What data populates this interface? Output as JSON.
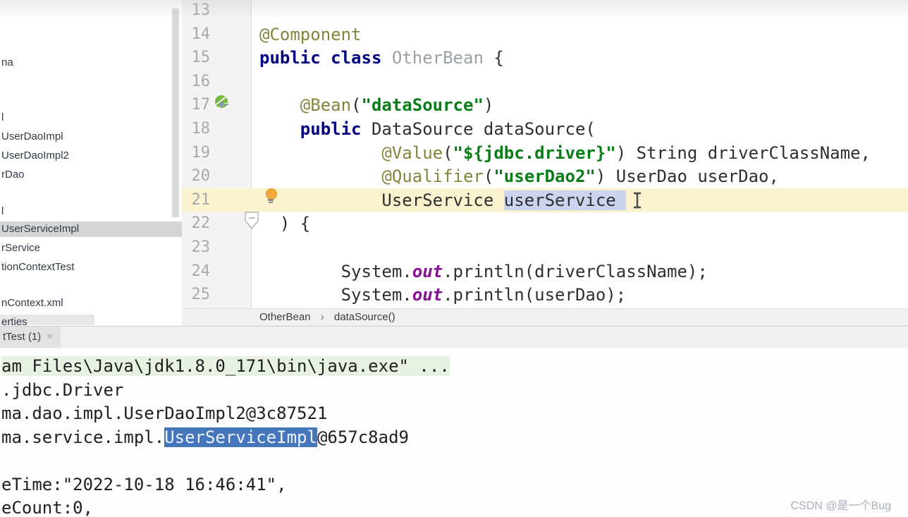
{
  "colors": {
    "keyword": "#000080",
    "annotation": "#84843c",
    "string": "#067d17",
    "static_field": "#871094",
    "caret_row": "#fbf2cf",
    "editor_selection": "#ccd5f0",
    "console_selection": "#4575bb",
    "run_command_highlight": "#e8f2e2",
    "tree_selection": "#d5d5d5"
  },
  "project_tree": {
    "items": [
      {
        "label": "na",
        "selected": false,
        "barred": false
      },
      {
        "label": "l",
        "selected": false,
        "barred": false
      },
      {
        "label": "UserDaoImpl",
        "selected": false,
        "barred": false
      },
      {
        "label": "UserDaoImpl2",
        "selected": false,
        "barred": false
      },
      {
        "label": "rDao",
        "selected": false,
        "barred": false
      },
      {
        "label": "l",
        "selected": false,
        "barred": false
      },
      {
        "label": "UserServiceImpl",
        "selected": true,
        "barred": false
      },
      {
        "label": "rService",
        "selected": false,
        "barred": false
      },
      {
        "label": "tionContextTest",
        "selected": false,
        "barred": false
      },
      {
        "label": "nContext.xml",
        "selected": false,
        "barred": false
      },
      {
        "label": "erties",
        "selected": false,
        "barred": true
      }
    ]
  },
  "editor": {
    "caret_line": 21,
    "lines": [
      {
        "n": 13,
        "tokens": []
      },
      {
        "n": 14,
        "tokens": [
          {
            "c": "a",
            "t": "@Component"
          }
        ]
      },
      {
        "n": 15,
        "tokens": [
          {
            "c": "k",
            "t": "public class "
          },
          {
            "c": "g",
            "t": "OtherBean "
          },
          {
            "c": "p",
            "t": "{"
          }
        ]
      },
      {
        "n": 16,
        "tokens": []
      },
      {
        "n": 17,
        "tokens": [
          {
            "c": "p",
            "t": "    "
          },
          {
            "c": "a",
            "t": "@Bean"
          },
          {
            "c": "p",
            "t": "("
          },
          {
            "c": "s",
            "t": "\"dataSource\""
          },
          {
            "c": "p",
            "t": ")"
          }
        ]
      },
      {
        "n": 18,
        "tokens": [
          {
            "c": "p",
            "t": "    "
          },
          {
            "c": "k",
            "t": "public "
          },
          {
            "c": "p",
            "t": "DataSource dataSource("
          }
        ]
      },
      {
        "n": 19,
        "tokens": [
          {
            "c": "p",
            "t": "            "
          },
          {
            "c": "a",
            "t": "@Value"
          },
          {
            "c": "p",
            "t": "("
          },
          {
            "c": "s",
            "t": "\"${jdbc.driver}\""
          },
          {
            "c": "p",
            "t": ") String driverClassName,"
          }
        ]
      },
      {
        "n": 20,
        "tokens": [
          {
            "c": "p",
            "t": "            "
          },
          {
            "c": "a",
            "t": "@Qualifier"
          },
          {
            "c": "p",
            "t": "("
          },
          {
            "c": "s",
            "t": "\"userDao2\""
          },
          {
            "c": "p",
            "t": ") UserDao userDao,"
          }
        ]
      },
      {
        "n": 21,
        "tokens": [
          {
            "c": "p",
            "t": "            UserService "
          },
          {
            "c": "sel",
            "t": "userService"
          }
        ]
      },
      {
        "n": 22,
        "tokens": [
          {
            "c": "p",
            "t": "  ) {"
          }
        ]
      },
      {
        "n": 23,
        "tokens": []
      },
      {
        "n": 24,
        "tokens": [
          {
            "c": "p",
            "t": "        System."
          },
          {
            "c": "f",
            "t": "out"
          },
          {
            "c": "p",
            "t": ".println(driverClassName);"
          }
        ]
      },
      {
        "n": 25,
        "tokens": [
          {
            "c": "p",
            "t": "        System."
          },
          {
            "c": "f",
            "t": "out"
          },
          {
            "c": "p",
            "t": ".println(userDao);"
          }
        ]
      }
    ],
    "gutter_icons": [
      {
        "line": 17,
        "icon": "spring-bean-icon"
      },
      {
        "line": 21,
        "icon": "lightbulb-icon"
      },
      {
        "line": 22,
        "icon": "fold-marker-icon"
      }
    ],
    "cursor": "ibeam-cursor"
  },
  "breadcrumb": {
    "class_name": "OtherBean",
    "separator": "›",
    "method_name": "dataSource()"
  },
  "console": {
    "tab_label": "tTest (1)",
    "close_icon": "×",
    "lines": [
      {
        "segments": [
          {
            "c": "green",
            "t": "am Files\\Java\\jdk1.8.0_171\\bin\\java.exe\" ..."
          }
        ]
      },
      {
        "segments": [
          {
            "c": "plain",
            "t": ".jdbc.Driver"
          }
        ]
      },
      {
        "segments": [
          {
            "c": "plain",
            "t": "ma.dao.impl.UserDaoImpl2@3c87521"
          }
        ]
      },
      {
        "segments": [
          {
            "c": "plain",
            "t": "ma.service.impl."
          },
          {
            "c": "sel",
            "t": "UserServiceImpl"
          },
          {
            "c": "plain",
            "t": "@657c8ad9"
          }
        ]
      },
      {
        "segments": []
      },
      {
        "segments": [
          {
            "c": "plain",
            "t": "eTime:\"2022-10-18 16:46:41\","
          }
        ]
      },
      {
        "segments": [
          {
            "c": "plain",
            "t": "eCount:0,"
          }
        ]
      }
    ]
  },
  "watermark": "CSDN @是一个Bug"
}
